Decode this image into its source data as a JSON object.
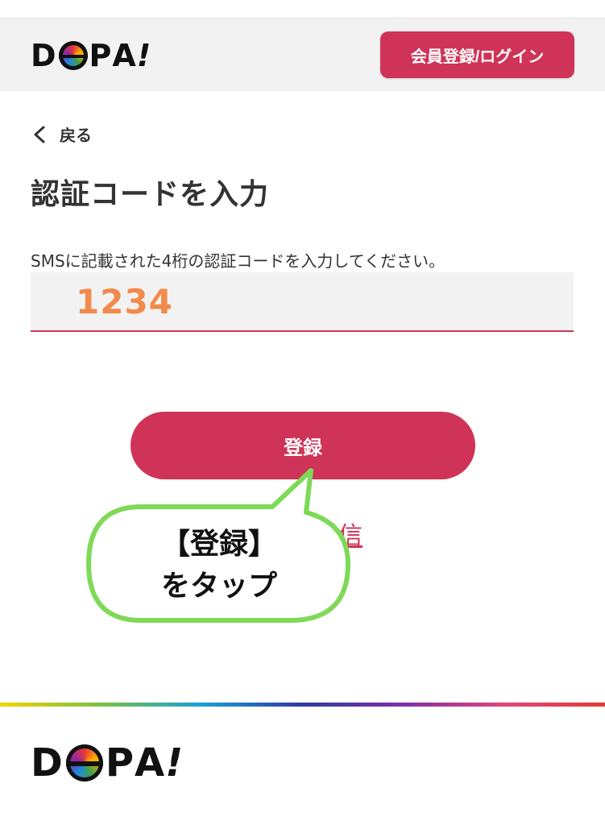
{
  "header": {
    "logo": {
      "d": "D",
      "p": "P",
      "a": "A",
      "mark": "!"
    },
    "login_label": "会員登録/ログイン"
  },
  "nav": {
    "back_label": "戻る"
  },
  "page": {
    "title": "認証コードを入力",
    "description": "SMSに記載された4桁の認証コードを入力してください。",
    "code_value": "1234"
  },
  "actions": {
    "register_label": "登録",
    "resend_label": "ドを再送信"
  },
  "callout": {
    "line1": "【登録】",
    "line2": "をタップ"
  },
  "footer": {
    "logo": {
      "d": "D",
      "p": "P",
      "a": "A",
      "mark": "!"
    }
  },
  "colors": {
    "accent": "#cf3357",
    "code_text": "#f28a4b",
    "callout_border": "#7ed957"
  }
}
